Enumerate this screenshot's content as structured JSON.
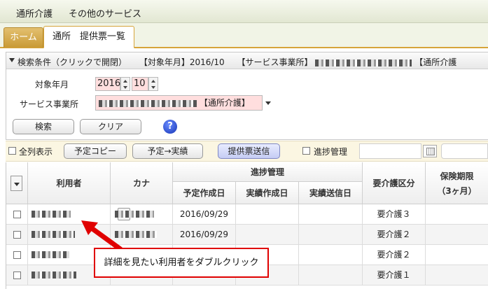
{
  "menu": {
    "items": [
      "通所介護",
      "その他のサービス"
    ]
  },
  "tabs": {
    "home": "ホーム",
    "active": "通所　提供票一覧"
  },
  "search": {
    "header_prefix": "検索条件（クリックで開閉）",
    "header_month": "【対象年月】2016/10",
    "header_office": "【サービス事業所】",
    "header_suffix": "【通所介護",
    "target_month_label": "対象年月",
    "year": "2016",
    "month": "10",
    "office_label": "サービス事業所",
    "office_suffix": "【通所介護】",
    "search_button": "検索",
    "clear_button": "クリア",
    "help": "?"
  },
  "toolbar": {
    "show_all": "全列表示",
    "copy_plan": "予定コピー",
    "plan_to_actual": "予定→実績",
    "send_sheet": "提供票送信",
    "progress_mgmt": "進捗管理"
  },
  "grid": {
    "headers": {
      "user": "利用者",
      "kana": "カナ",
      "progress": "進捗管理",
      "plan_date": "予定作成日",
      "actual_date": "実績作成日",
      "actual_send": "実績送信日",
      "care_level": "要介護区分",
      "insurance_term": "保険期限",
      "insurance_term_sub": "（3ヶ月）"
    },
    "rows": [
      {
        "plan_date": "2016/09/29",
        "care_level": "要介護３"
      },
      {
        "plan_date": "2016/09/29",
        "care_level": "要介護２"
      },
      {
        "plan_date": "",
        "care_level": "要介護２"
      },
      {
        "plan_date": "",
        "care_level": "要介護１"
      }
    ],
    "ellipsis": "..."
  },
  "annotation": {
    "text": "詳細を見たい利用者をダブルクリック"
  },
  "colors": {
    "required_bg": "#ffdede",
    "tab_accent": "#d6a43a",
    "annotation_red": "#e00000"
  }
}
